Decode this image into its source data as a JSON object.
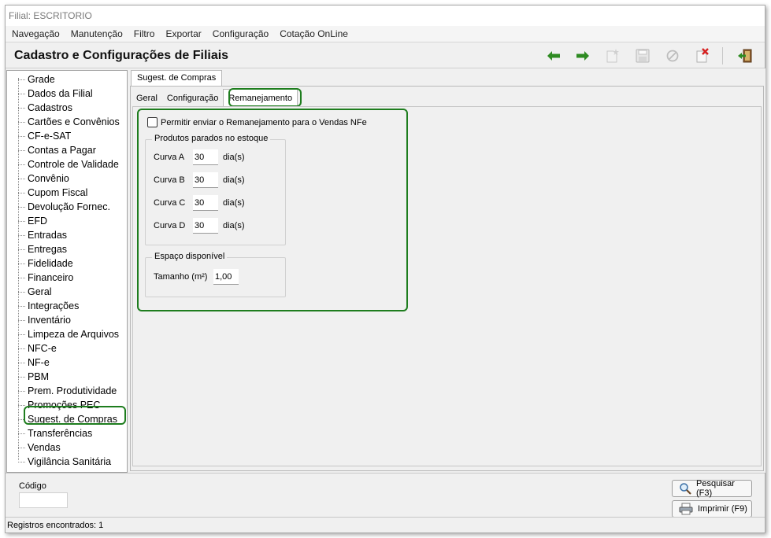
{
  "window": {
    "title": "Filial: ESCRITORIO"
  },
  "menu": [
    "Navegação",
    "Manutenção",
    "Filtro",
    "Exportar",
    "Configuração",
    "Cotação OnLine"
  ],
  "header": {
    "title": "Cadastro e Configurações de Filiais"
  },
  "toolbar": {
    "icons": [
      "arrow-left-icon",
      "arrow-right-icon",
      "new-icon",
      "save-icon",
      "cancel-icon",
      "delete-icon",
      "exit-icon"
    ]
  },
  "sidebar": {
    "items": [
      "Grade",
      "Dados da Filial",
      "Cadastros",
      "Cartões e Convênios",
      "CF-e-SAT",
      "Contas a Pagar",
      "Controle de Validade",
      "Convênio",
      "Cupom Fiscal",
      "Devolução Fornec.",
      "EFD",
      "Entradas",
      "Entregas",
      "Fidelidade",
      "Financeiro",
      "Geral",
      "Integrações",
      "Inventário",
      "Limpeza de Arquivos",
      "NFC-e",
      "NF-e",
      "PBM",
      "Prem. Produtividade",
      "Promoções PEC",
      "Sugest. de Compras",
      "Transferências",
      "Vendas",
      "Vigilância Sanitária"
    ],
    "selected_index": 24
  },
  "tabs": {
    "outer": "Sugest. de Compras",
    "inner": [
      "Geral",
      "Configuração",
      "Remanejamento"
    ],
    "active_inner": "Remanejamento"
  },
  "remanejamento": {
    "checkbox_label": "Permitir enviar o Remanejamento para o Vendas NFe",
    "checkbox_checked": false,
    "produtos_title": "Produtos parados no estoque",
    "curvas": [
      {
        "label": "Curva A",
        "value": "30",
        "unit": "dia(s)"
      },
      {
        "label": "Curva B",
        "value": "30",
        "unit": "dia(s)"
      },
      {
        "label": "Curva C",
        "value": "30",
        "unit": "dia(s)"
      },
      {
        "label": "Curva D",
        "value": "30",
        "unit": "dia(s)"
      }
    ],
    "espaco_title": "Espaço disponível",
    "tamanho_label": "Tamanho (m²)",
    "tamanho_value": "1,00"
  },
  "bottom": {
    "codigo_label": "Código",
    "codigo_value": "",
    "pesquisar_label": "Pesquisar (F3)",
    "imprimir_label": "Imprimir (F9)"
  },
  "status": {
    "text": "Registros encontrados: 1"
  },
  "colors": {
    "highlight": "#1e7d1e",
    "arrow": "#2e8b22"
  }
}
